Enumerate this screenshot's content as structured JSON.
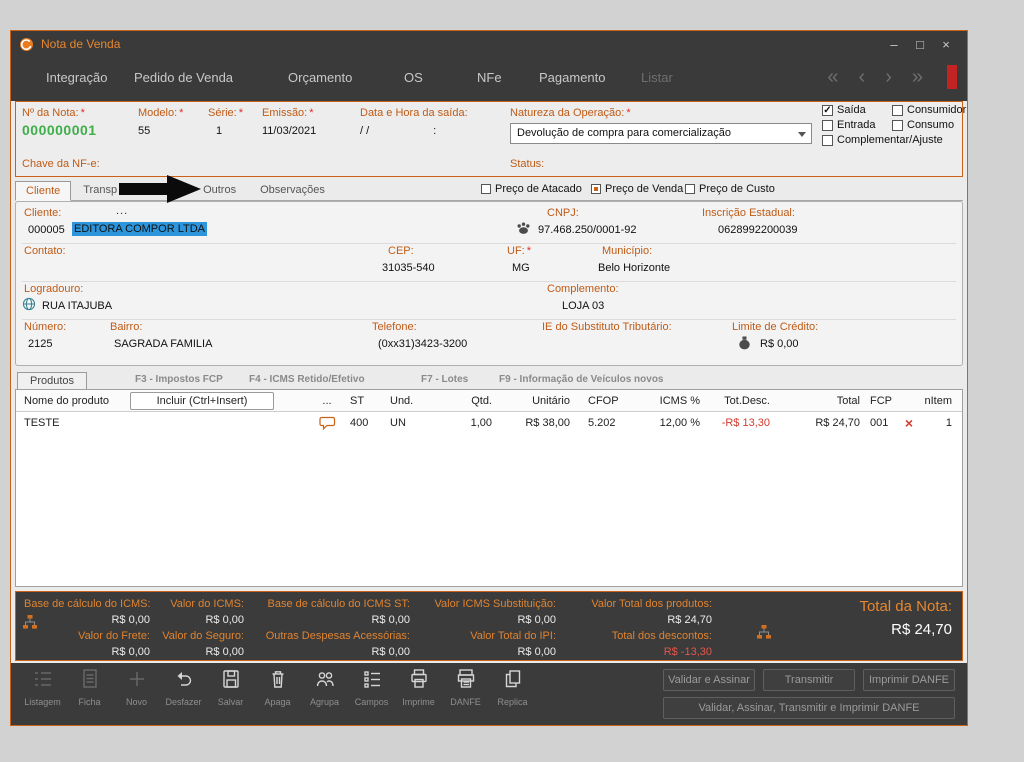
{
  "required_mark": "*",
  "window": {
    "title": "Nota de Venda"
  },
  "window_controls": {
    "minimize": "–",
    "maximize": "□",
    "close": "×"
  },
  "menu": {
    "items": [
      "Integração",
      "Pedido de Venda",
      "Orçamento",
      "OS",
      "NFe",
      "Pagamento",
      "Listar"
    ],
    "nav": {
      "first": "«",
      "prev": "‹",
      "next": "›",
      "last": "»"
    }
  },
  "header": {
    "nota": {
      "label": "Nº da Nota:",
      "value": "000000001"
    },
    "modelo": {
      "label": "Modelo:",
      "value": "55"
    },
    "serie": {
      "label": "Série:",
      "value": "1"
    },
    "emissao": {
      "label": "Emissão:",
      "value": "11/03/2021"
    },
    "saida": {
      "label": "Data e Hora da saída:",
      "date_value": "/  /",
      "time_value": ":"
    },
    "natureza": {
      "label": "Natureza da Operação:",
      "value": "Devolução de compra para comercialização"
    },
    "checkboxes": [
      {
        "label": "Saída",
        "checked": true
      },
      {
        "label": "Consumidor",
        "checked": false
      },
      {
        "label": "Entrada",
        "checked": false
      },
      {
        "label": "Consumo",
        "checked": false
      },
      {
        "label": "Complementar/Ajuste",
        "checked": false
      }
    ],
    "check_glyph": "✓",
    "chave_label": "Chave da NF-e:",
    "status_label": "Status:"
  },
  "tabs": {
    "cliente": "Cliente",
    "transportadora": "Transp",
    "outros": "Outros",
    "observacoes": "Observações",
    "price_options": [
      {
        "label": "Preço de Atacado",
        "selected": false
      },
      {
        "label": "Preço de Venda",
        "selected": true
      },
      {
        "label": "Preço de Custo",
        "selected": false
      }
    ]
  },
  "cliente": {
    "cliente_label": "Cliente:",
    "more_button": "...",
    "codigo": "000005",
    "nome": "EDITORA COMPOR LTDA",
    "cnpj_label": "CNPJ:",
    "cnpj": "97.468.250/0001-92",
    "insc_label": "Inscrição Estadual:",
    "insc": "0628992200039",
    "contato_label": "Contato:",
    "cep_label": "CEP:",
    "cep": "31035-540",
    "uf_label": "UF:",
    "uf": "MG",
    "municipio_label": "Município:",
    "municipio": "Belo Horizonte",
    "logradouro_label": "Logradouro:",
    "logradouro": "RUA ITAJUBA",
    "complemento_label": "Complemento:",
    "complemento": "LOJA 03",
    "numero_label": "Número:",
    "numero": "2125",
    "bairro_label": "Bairro:",
    "bairro": "SAGRADA FAMILIA",
    "telefone_label": "Telefone:",
    "telefone": "(0xx31)3423-3200",
    "ie_subst_label": "IE do Substituto Tributário:",
    "limite_label": "Limite de Crédito:",
    "limite": "R$ 0,00"
  },
  "produtos": {
    "tab": "Produtos",
    "hints": [
      "F3 - Impostos FCP",
      "F4 - ICMS Retido/Efetivo",
      "F7 - Lotes",
      "F9 - Informação de Veículos novos"
    ],
    "incluir_button": "Incluir (Ctrl+Insert)",
    "columns": {
      "nome": "Nome do produto",
      "dots": "...",
      "st": "ST",
      "und": "Und.",
      "qtd": "Qtd.",
      "unitario": "Unitário",
      "cfop": "CFOP",
      "icms": "ICMS %",
      "desc": "Tot.Desc.",
      "total": "Total",
      "fcp": "FCP",
      "nitem": "nItem"
    },
    "row": {
      "nome": "TESTE",
      "st": "400",
      "und": "UN",
      "qtd": "1,00",
      "unitario": "R$ 38,00",
      "cfop": "5.202",
      "icms": "12,00 %",
      "desc": "-R$ 13,30",
      "total": "R$ 24,70",
      "fcp": "001",
      "delete_glyph": "×",
      "nitem": "1"
    }
  },
  "totais": {
    "fields": [
      {
        "label": "Base de cálculo do ICMS:",
        "value": "R$ 0,00"
      },
      {
        "label": "Valor do ICMS:",
        "value": "R$ 0,00"
      },
      {
        "label": "Base de cálculo do ICMS ST:",
        "value": "R$ 0,00"
      },
      {
        "label": "Valor ICMS Substituição:",
        "value": "R$ 0,00"
      },
      {
        "label": "Valor Total dos produtos:",
        "value": "R$ 24,70"
      },
      {
        "label": "Valor do Frete:",
        "value": "R$ 0,00"
      },
      {
        "label": "Valor do Seguro:",
        "value": "R$ 0,00"
      },
      {
        "label": "Outras Despesas Acessórias:",
        "value": "R$ 0,00"
      },
      {
        "label": "Valor Total do IPI:",
        "value": "R$ 0,00"
      },
      {
        "label": "Total dos descontos:",
        "value": "R$ -13,30"
      }
    ],
    "total_label": "Total da Nota:",
    "total_value": "R$ 24,70"
  },
  "toolbar": {
    "items": [
      {
        "label": "Listagem"
      },
      {
        "label": "Ficha"
      },
      {
        "label": "Novo"
      },
      {
        "label": "Desfazer"
      },
      {
        "label": "Salvar"
      },
      {
        "label": "Apaga"
      },
      {
        "label": "Agrupa"
      },
      {
        "label": "Campos"
      },
      {
        "label": "Imprime"
      },
      {
        "label": "DANFE"
      },
      {
        "label": "Replica"
      }
    ],
    "buttons": [
      "Validar e Assinar",
      "Transmitir",
      "Imprimir DANFE"
    ],
    "wide_button": "Validar, Assinar, Transmitir e Imprimir DANFE"
  }
}
